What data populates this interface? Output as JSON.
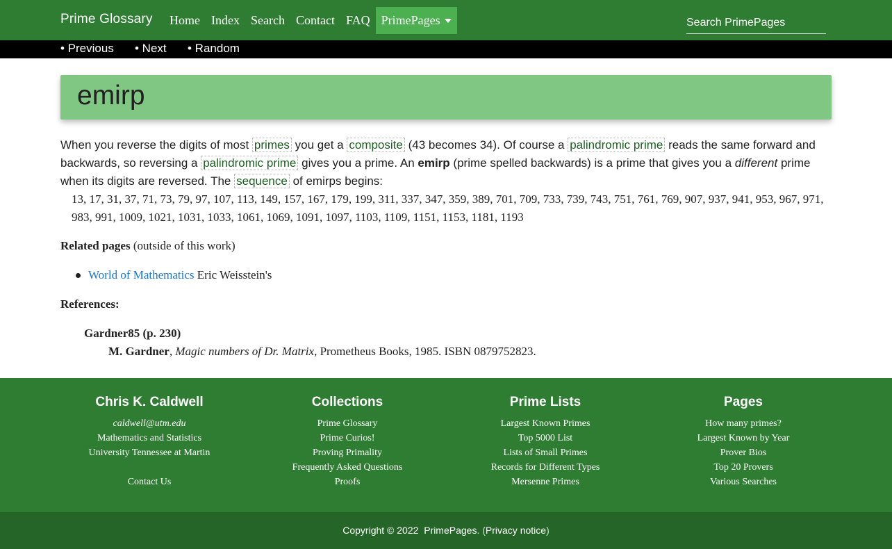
{
  "nav": {
    "brand": "Prime Glossary",
    "links": [
      "Home",
      "Index",
      "Search",
      "Contact",
      "FAQ"
    ],
    "dropdown": "PrimePages",
    "search_placeholder": "Search PrimePages"
  },
  "subnav": {
    "previous": "• Previous",
    "next": "• Next",
    "random": "• Random"
  },
  "title": "emirp",
  "body": {
    "p1": "When you reverse the digits of most",
    "link_primes": "primes",
    "p2": "you get a",
    "link_composite": "composite",
    "p3": "(43 becomes 34).  Of course a",
    "link_palindromic1": "palindromic prime",
    "p4": "reads the same forward and backwards, so reversing a",
    "link_palindromic2": "palindromic prime",
    "p5": "gives you a prime.  An",
    "emirp_bold": "emirp",
    "p6": "(prime spelled backwards) is a prime that gives you a",
    "different_italic": "different",
    "p7": "prime when its digits are reversed.  The",
    "link_sequence": "sequence",
    "p8": "of emirps begins:",
    "sequence": "13, 17, 31, 37, 71, 73, 79, 97, 107, 113, 149, 157, 167, 179, 199, 311, 337, 347, 359, 389, 701, 709, 733, 739, 743, 751, 761, 769, 907, 937, 941, 953, 967, 971, 983, 991, 1009, 1021, 1031, 1033, 1061, 1069, 1091, 1097, 1103, 1109, 1151, 1153, 1181, 1193"
  },
  "related": {
    "heading": "Related pages",
    "qualifier": "(outside of this work)",
    "item_link": "World of Mathematics",
    "item_text": "Eric Weisstein's"
  },
  "references": {
    "heading": "References:",
    "key": "Gardner85 (p. 230)",
    "author": "M. Gardner",
    "book": "Magic numbers of Dr. Matrix",
    "rest": ", Prometheus Books, 1985.  ISBN 0879752823."
  },
  "footer": {
    "col1": {
      "heading": "Chris K. Caldwell",
      "email": "caldwell@utm.edu",
      "line2": "Mathematics and Statistics",
      "line3": "University Tennessee at Martin",
      "contact": "Contact Us"
    },
    "col2": {
      "heading": "Collections",
      "items": [
        "Prime Glossary",
        "Prime Curios!",
        "Proving Primality",
        "Frequently Asked Questions",
        "Proofs"
      ]
    },
    "col3": {
      "heading": "Prime Lists",
      "items": [
        "Largest Known Primes",
        "Top 5000 List",
        "Lists of Small Primes",
        "Records for Different Types",
        "Mersenne Primes"
      ]
    },
    "col4": {
      "heading": "Pages",
      "items": [
        "How many primes?",
        "Largest Known by Year",
        "Prover Bios",
        "Top 20 Provers",
        "Various Searches"
      ]
    },
    "copyright": "Copyright © 2022",
    "site": "PrimePages",
    "privacy_open": ".  (",
    "privacy": "Privacy notice",
    "privacy_close": ")"
  },
  "colors": {
    "nav_green": "#2e7d32",
    "title_green": "#81c784",
    "link_blue": "#1976d2",
    "copy_green": "#256628"
  }
}
